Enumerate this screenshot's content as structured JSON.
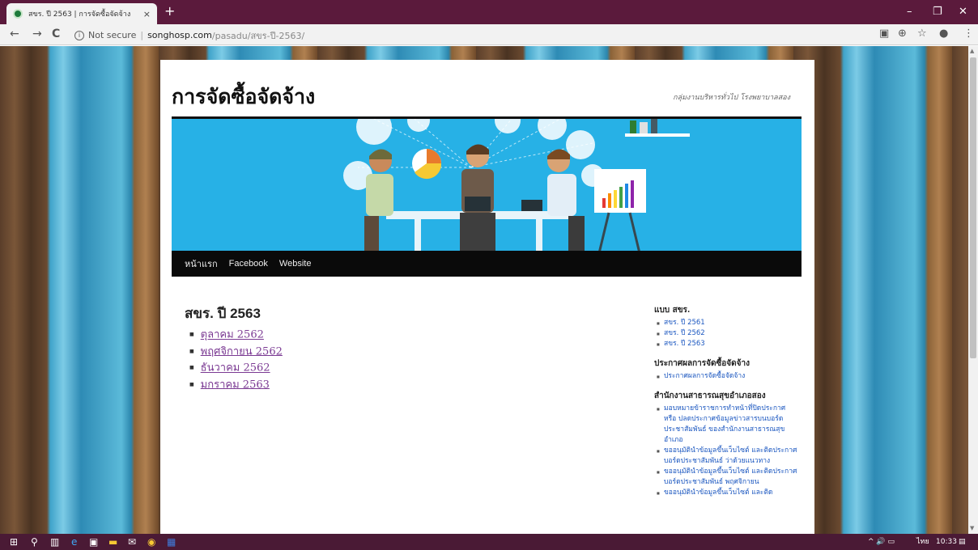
{
  "browser": {
    "tab_title": "สขร. ปี 2563 | การจัดซื้อจัดจ้าง",
    "tab_close": "×",
    "new_tab": "+",
    "window_controls": {
      "minimize": "–",
      "restore": "❐",
      "close": "✕"
    },
    "nav": {
      "back": "←",
      "forward": "→",
      "reload": "C"
    },
    "info_glyph": "i",
    "security_label": "Not secure",
    "separator": "|",
    "url_host": "songhosp.com",
    "url_path": "/pasadu/สขร-ปี-2563/",
    "toolbar_icons": {
      "translate": "▣",
      "zoom": "⊕",
      "star": "☆",
      "profile": "●",
      "menu": "⋮"
    }
  },
  "site": {
    "title": "การจัดซื้อจัดจ้าง",
    "description": "กลุ่มงานบริหารทั่วไป โรงพยาบาลสอง",
    "menu": [
      "หน้าแรก",
      "Facebook",
      "Website"
    ]
  },
  "content": {
    "title": "สขร. ปี 2563",
    "items": [
      "ตุลาคม 2562",
      "พฤศจิกายน 2562",
      "ธันวาคม 2562",
      "มกราคม 2563"
    ]
  },
  "sidebar": {
    "widgets": [
      {
        "title": "แบบ สขร.",
        "items": [
          "สขร. ปี 2561",
          "สขร. ปี 2562",
          "สขร. ปี 2563"
        ]
      },
      {
        "title": "ประกาศผลการจัดซื้อจัดจ้าง",
        "items": [
          "ประกาศผลการจัดซื้อจัดจ้าง"
        ]
      },
      {
        "title": "สำนักงานสาธารณสุขอำเภอสอง",
        "items": [
          "มอบหมายข้าราชการทำหน้าที่ปิดประกาศ หรือ ปลดประกาศข้อมูลข่าวสารบนบอร์ดประชาสัมพันธ์ ของสำนักงานสาธารณสุขอำเภอ",
          "ขออนุมัตินำข้อมูลขึ้นเว็บไซต์ และติดประกาศบอร์ดประชาสัมพันธ์ ว่าด้วยแนวทาง",
          "ขออนุมัตินำข้อมูลขึ้นเว็บไซต์ และติดประกาศบอร์ดประชาสัมพันธ์ พฤศจิกายน",
          "ขออนุมัตินำข้อมูลขึ้นเว็บไซต์ และติด"
        ]
      }
    ]
  },
  "taskbar": {
    "tray_icons": "^ 🔊 ▭",
    "language": "ไทย",
    "time": "10:33",
    "notifications": "▤"
  },
  "colors": {
    "titlebar": "#5b1a3c",
    "banner": "#27b1e6",
    "nav": "#0a0a0a",
    "link": "#7b3a93",
    "sidebar_link": "#1b57c0"
  }
}
